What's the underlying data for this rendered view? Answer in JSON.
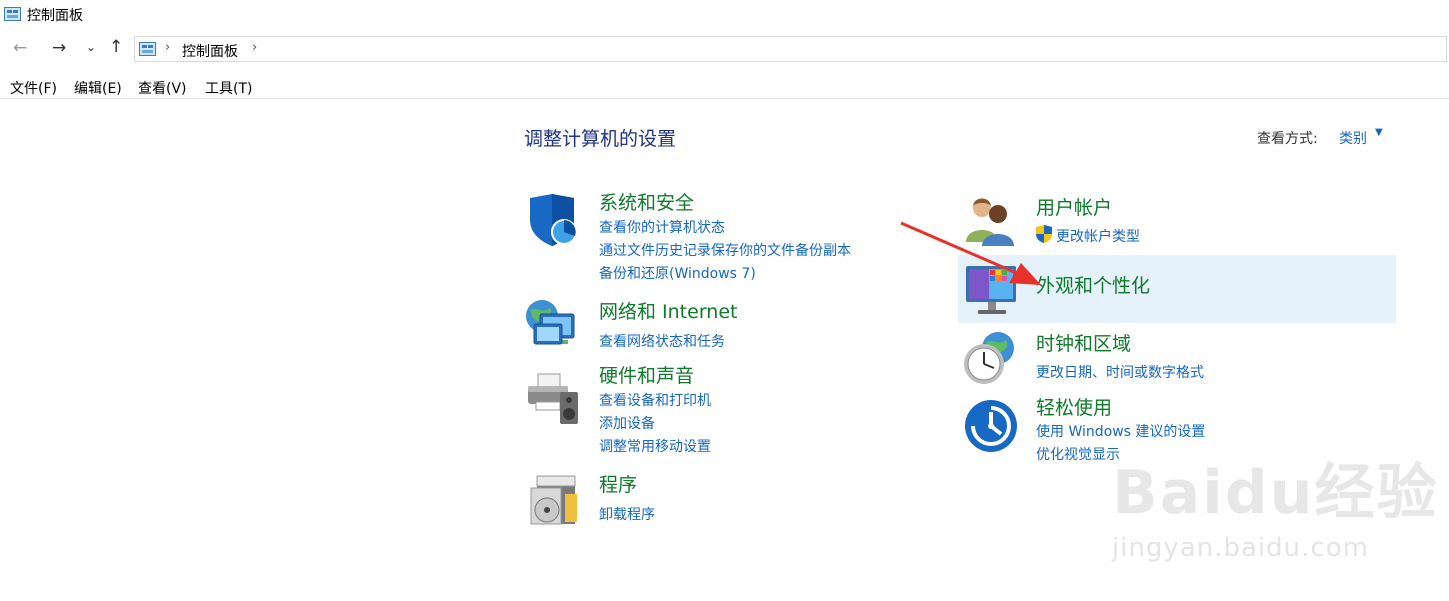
{
  "window": {
    "title": "控制面板"
  },
  "address": {
    "crumb": "控制面板",
    "separator": "›"
  },
  "nav": {
    "back": "←",
    "forward": "→",
    "recent": "⌄",
    "up": "↑"
  },
  "menu": [
    "文件(F)",
    "编辑(E)",
    "查看(V)",
    "工具(T)"
  ],
  "main": {
    "heading": "调整计算机的设置",
    "view_by_label": "查看方式:",
    "view_by_value": "类别"
  },
  "categories": {
    "system_security": {
      "title": "系统和安全",
      "links": [
        "查看你的计算机状态",
        "通过文件历史记录保存你的文件备份副本",
        "备份和还原(Windows 7)"
      ]
    },
    "network": {
      "title": "网络和 Internet",
      "links": [
        "查看网络状态和任务"
      ]
    },
    "hardware": {
      "title": "硬件和声音",
      "links": [
        "查看设备和打印机",
        "添加设备",
        "调整常用移动设置"
      ]
    },
    "programs": {
      "title": "程序",
      "links": [
        "卸载程序"
      ]
    },
    "user_accounts": {
      "title": "用户帐户",
      "links": [
        "更改帐户类型"
      ]
    },
    "appearance": {
      "title": "外观和个性化",
      "links": []
    },
    "clock_region": {
      "title": "时钟和区域",
      "links": [
        "更改日期、时间或数字格式"
      ]
    },
    "ease_of_access": {
      "title": "轻松使用",
      "links": [
        "使用 Windows 建议的设置",
        "优化视觉显示"
      ]
    }
  },
  "watermark": {
    "logo": "Baidu经验",
    "url": "jingyan.baidu.com"
  },
  "colors": {
    "link": "#1667c2",
    "category_title": "#0f7a2a",
    "heading": "#1e3287",
    "hover": "#e5f1fb",
    "annotation_arrow": "#e8312a"
  }
}
